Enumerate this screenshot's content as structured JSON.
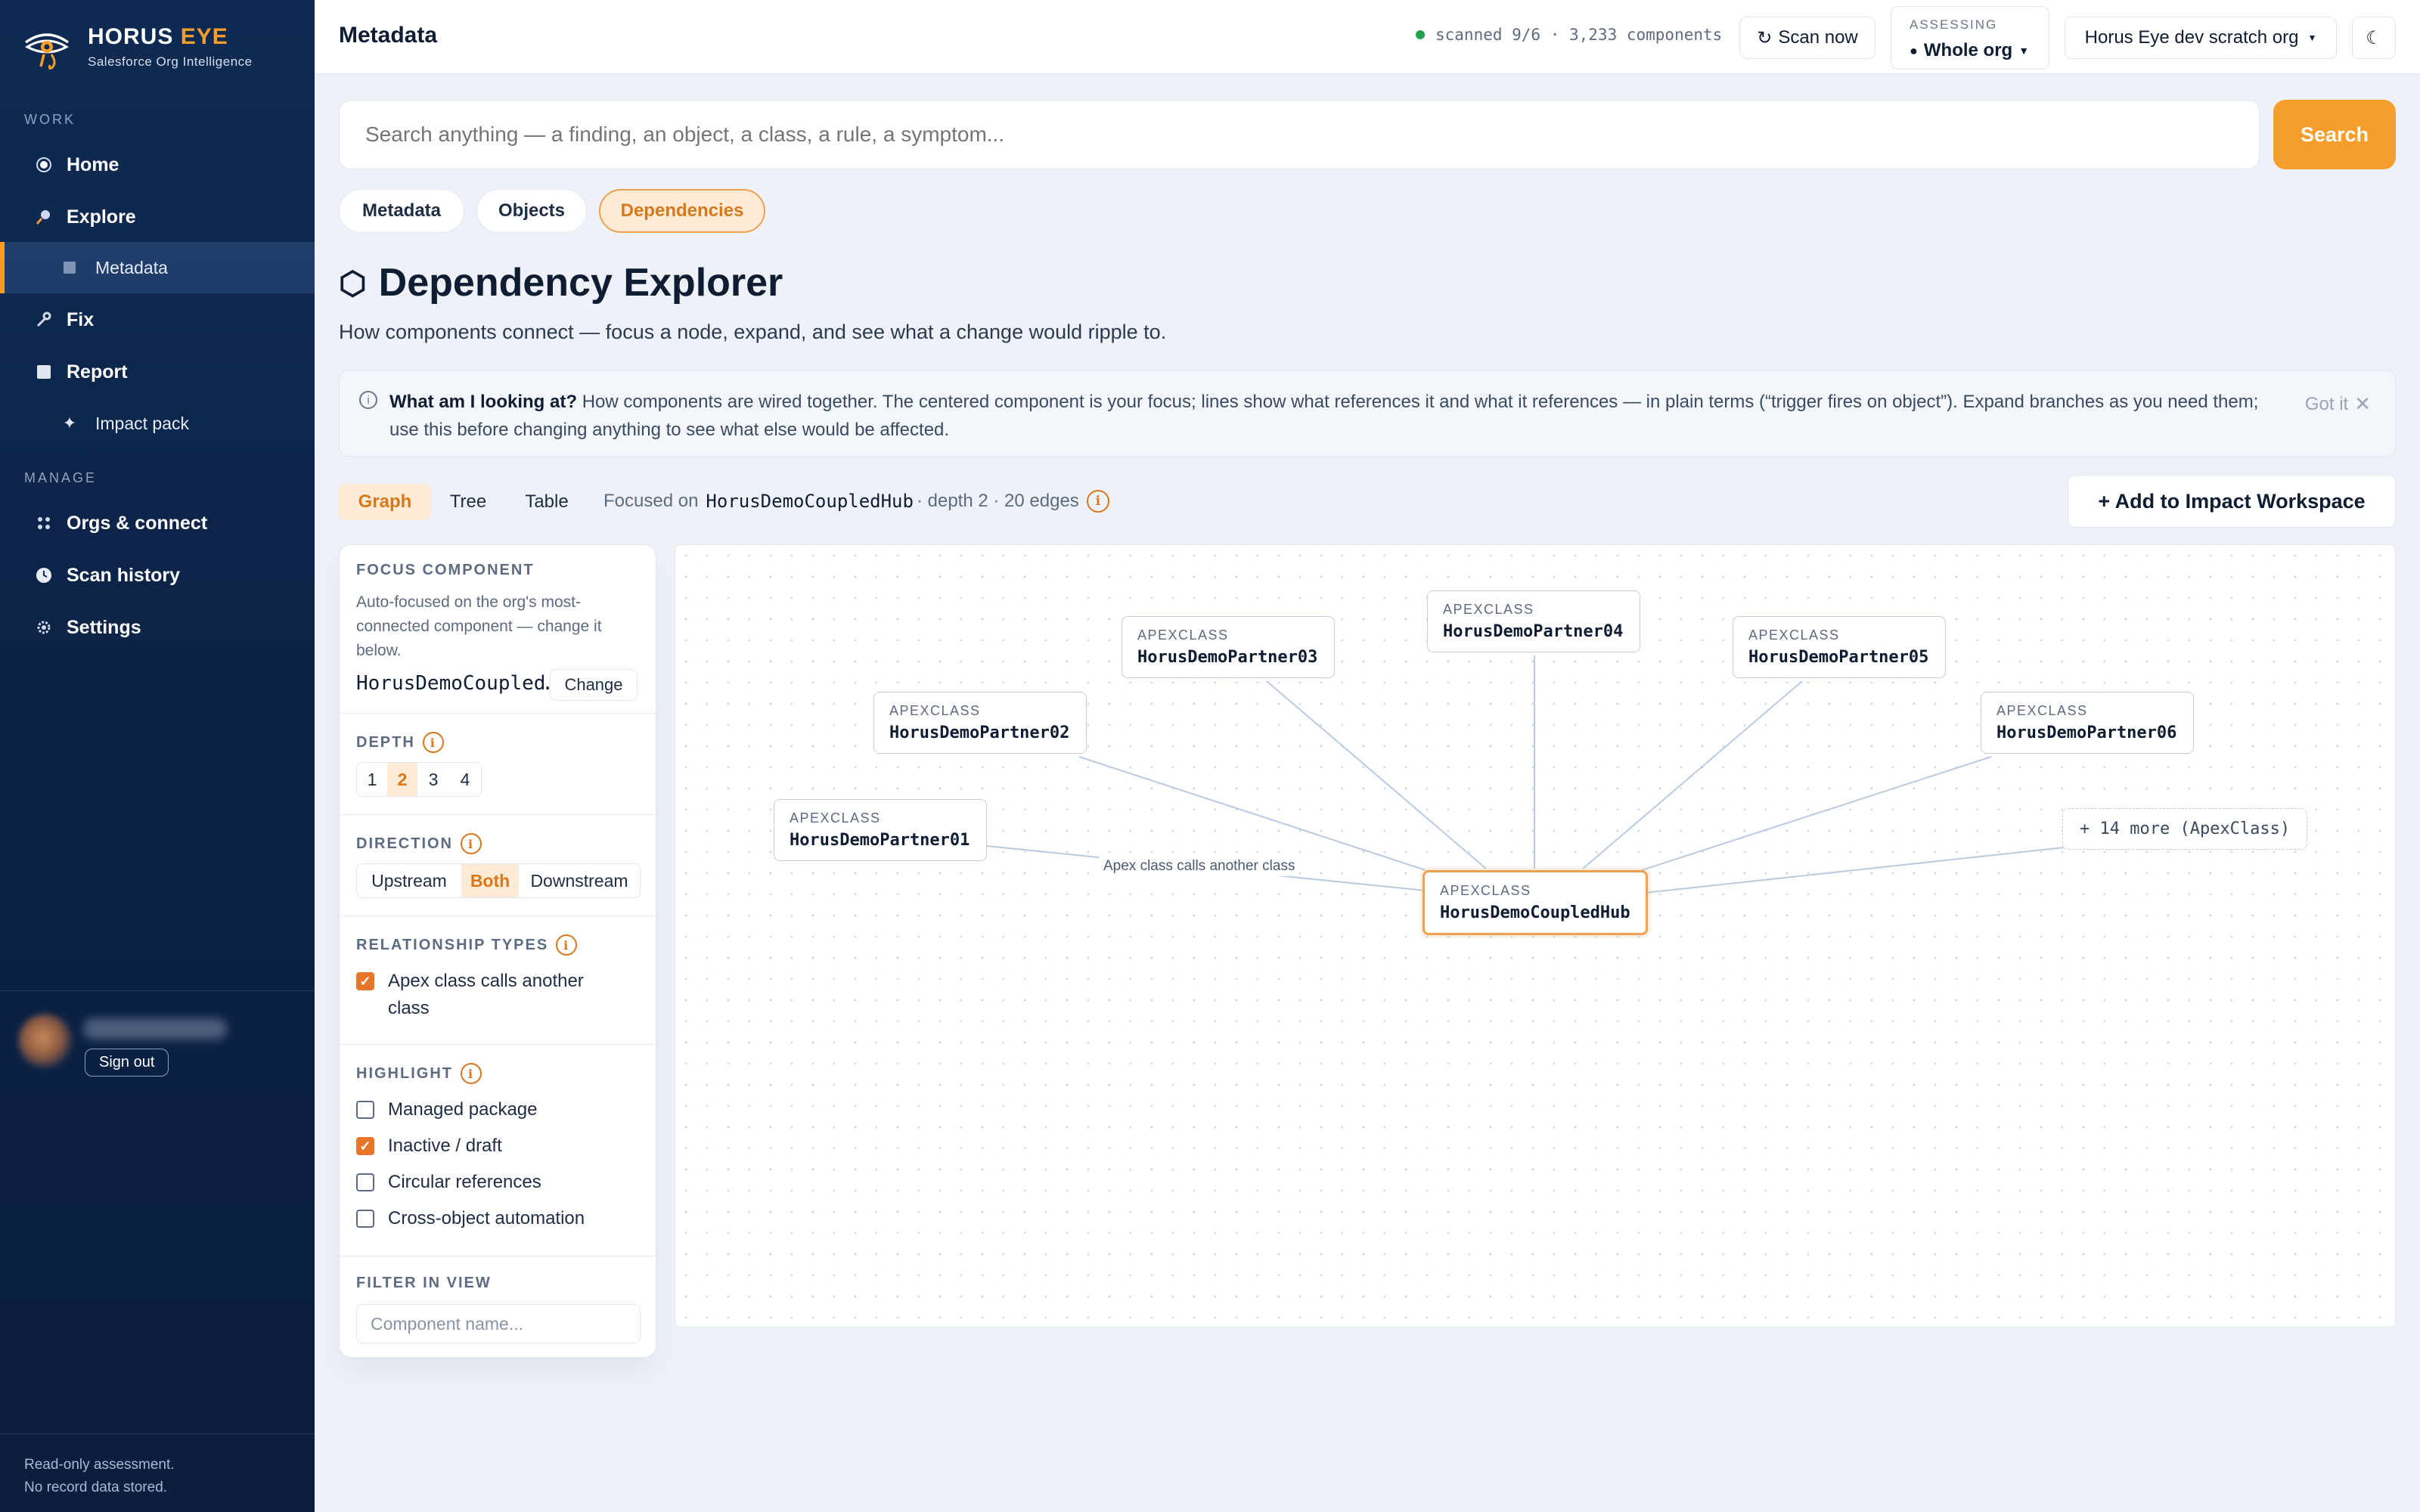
{
  "brand": {
    "name_main": "HORUS",
    "name_accent": "EYE",
    "subtitle": "Salesforce Org Intelligence"
  },
  "sidebar": {
    "work_label": "WORK",
    "manage_label": "MANAGE",
    "items": {
      "home": "Home",
      "explore": "Explore",
      "metadata": "Metadata",
      "fix": "Fix",
      "report": "Report",
      "impact_pack": "Impact pack",
      "orgs": "Orgs & connect",
      "scan_history": "Scan history",
      "settings": "Settings"
    },
    "sign_out": "Sign out",
    "footer_line1": "Read-only assessment.",
    "footer_line2": "No record data stored."
  },
  "topbar": {
    "title": "Metadata",
    "scan_status": "scanned 9/6 · 3,233 components",
    "scan_now": "Scan now",
    "assessing_label": "ASSESSING",
    "assessing_value": "Whole org",
    "org_name": "Horus Eye dev scratch org",
    "theme_icon": "☾"
  },
  "search": {
    "placeholder": "Search anything — a finding, an object, a class, a rule, a symptom...",
    "button": "Search"
  },
  "pills": {
    "metadata": "Metadata",
    "objects": "Objects",
    "dependencies": "Dependencies"
  },
  "page": {
    "title": "Dependency Explorer",
    "description": "How components connect — focus a node, expand, and see what a change would ripple to."
  },
  "info": {
    "lead": "What am I looking at?",
    "body": "How components are wired together. The centered component is your focus; lines show what references it and what it references — in plain terms (“trigger fires on object”). Expand branches as you need them; use this before changing anything to see what else would be affected.",
    "got_it": "Got it"
  },
  "view_tabs": {
    "graph": "Graph",
    "tree": "Tree",
    "table": "Table"
  },
  "focus_line": {
    "prefix": "Focused on",
    "component": "HorusDemoCoupledHub",
    "suffix": "· depth 2 · 20 edges"
  },
  "add_impact": "+ Add to Impact Workspace",
  "panel": {
    "focus_label": "FOCUS COMPONENT",
    "focus_help": "Auto-focused on the org's most-connected component — change it below.",
    "focus_value": "HorusDemoCoupled…",
    "change": "Change",
    "depth_label": "DEPTH",
    "depth_options": [
      "1",
      "2",
      "3",
      "4"
    ],
    "depth_selected": "2",
    "direction_label": "DIRECTION",
    "direction_options": [
      "Upstream",
      "Both",
      "Downstream"
    ],
    "direction_selected": "Both",
    "relationship_label": "RELATIONSHIP TYPES",
    "relationship_item": "Apex class calls another class",
    "highlight_label": "HIGHLIGHT",
    "highlights": [
      {
        "label": "Managed package",
        "checked": false
      },
      {
        "label": "Inactive / draft",
        "checked": true
      },
      {
        "label": "Circular references",
        "checked": false
      },
      {
        "label": "Cross-object automation",
        "checked": false
      }
    ],
    "filter_label": "FILTER IN VIEW",
    "filter_placeholder": "Component name..."
  },
  "graph": {
    "node_type": "APEXCLASS",
    "focus": "HorusDemoCoupledHub",
    "partners": [
      "HorusDemoPartner01",
      "HorusDemoPartner02",
      "HorusDemoPartner03",
      "HorusDemoPartner04",
      "HorusDemoPartner05",
      "HorusDemoPartner06"
    ],
    "more": "+ 14 more (ApexClass)",
    "edge_label": "Apex class calls another class",
    "edge_color": "#b9cbe0"
  },
  "colors": {
    "accent": "#f59e2b",
    "sidebar": "#0f2a52",
    "success": "#22a04b"
  }
}
